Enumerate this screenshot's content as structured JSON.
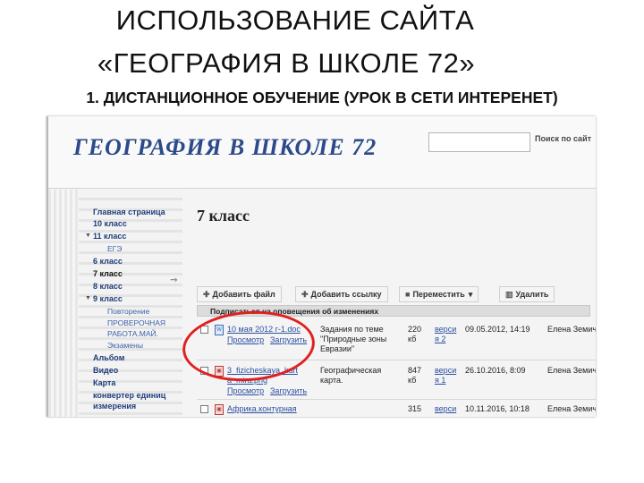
{
  "slide": {
    "title_line1": "ИСПОЛЬЗОВАНИЕ САЙТА",
    "title_line2": "«ГЕОГРАФИЯ В ШКОЛЕ 72»",
    "subtitle": "1. ДИСТАНЦИОННОЕ ОБУЧЕНИЕ (УРОК В СЕТИ ИНТЕРЕНЕТ)"
  },
  "site": {
    "logo": "ГЕОГРАФИЯ В ШКОЛЕ 72",
    "search_button": "Поиск по сайт"
  },
  "sidebar": {
    "items": [
      {
        "label": "Главная страница"
      },
      {
        "label": "10 класс"
      },
      {
        "label": "11 класс"
      },
      {
        "label": "ЕГЭ"
      },
      {
        "label": "6 класс"
      },
      {
        "label": "7 класс"
      },
      {
        "label": "8 класс"
      },
      {
        "label": "9 класс"
      },
      {
        "label": "Повторение"
      },
      {
        "label": "ПРОВЕРОЧНАЯ"
      },
      {
        "label": "РАБОТА.МАЙ."
      },
      {
        "label": "Экзамены"
      },
      {
        "label": "Альбом"
      },
      {
        "label": "Видео"
      },
      {
        "label": "Карта"
      },
      {
        "label": "конвертер единиц"
      },
      {
        "label": "измерения"
      }
    ]
  },
  "main": {
    "heading": "7 класс",
    "toolbar": {
      "add_file": "Добавить файл",
      "add_link": "Добавить ссылку",
      "move": "Переместить",
      "delete": "Удалить"
    },
    "notify": "Подписаться на оповещения об изменениях",
    "rows": [
      {
        "name": "10 мая 2012 г-1.doc",
        "view": "Просмотр",
        "download": "Загрузить",
        "desc1": "Задания по теме",
        "desc2": "\"Природные зоны",
        "desc3": "Евразии\"",
        "size1": "220",
        "size2": "кб",
        "ver1": "верси",
        "ver2": "я 2",
        "date": "09.05.2012, 14:19",
        "author": "Елена Земич"
      },
      {
        "name": "3_fizicheskaya_kart",
        "name2": "a_mira.png",
        "view": "Просмотр",
        "download": "Загрузить",
        "desc1": "Географическая",
        "desc2": "карта.",
        "size1": "847",
        "size2": "кб",
        "ver1": "верси",
        "ver2": "я 1",
        "date": "26.10.2016, 8:09",
        "author": "Елена Земич"
      },
      {
        "name": "Африка.контурная",
        "size1": "315",
        "ver1": "верси",
        "date": "10.11.2016, 10:18",
        "author": "Елена Земич"
      }
    ]
  }
}
